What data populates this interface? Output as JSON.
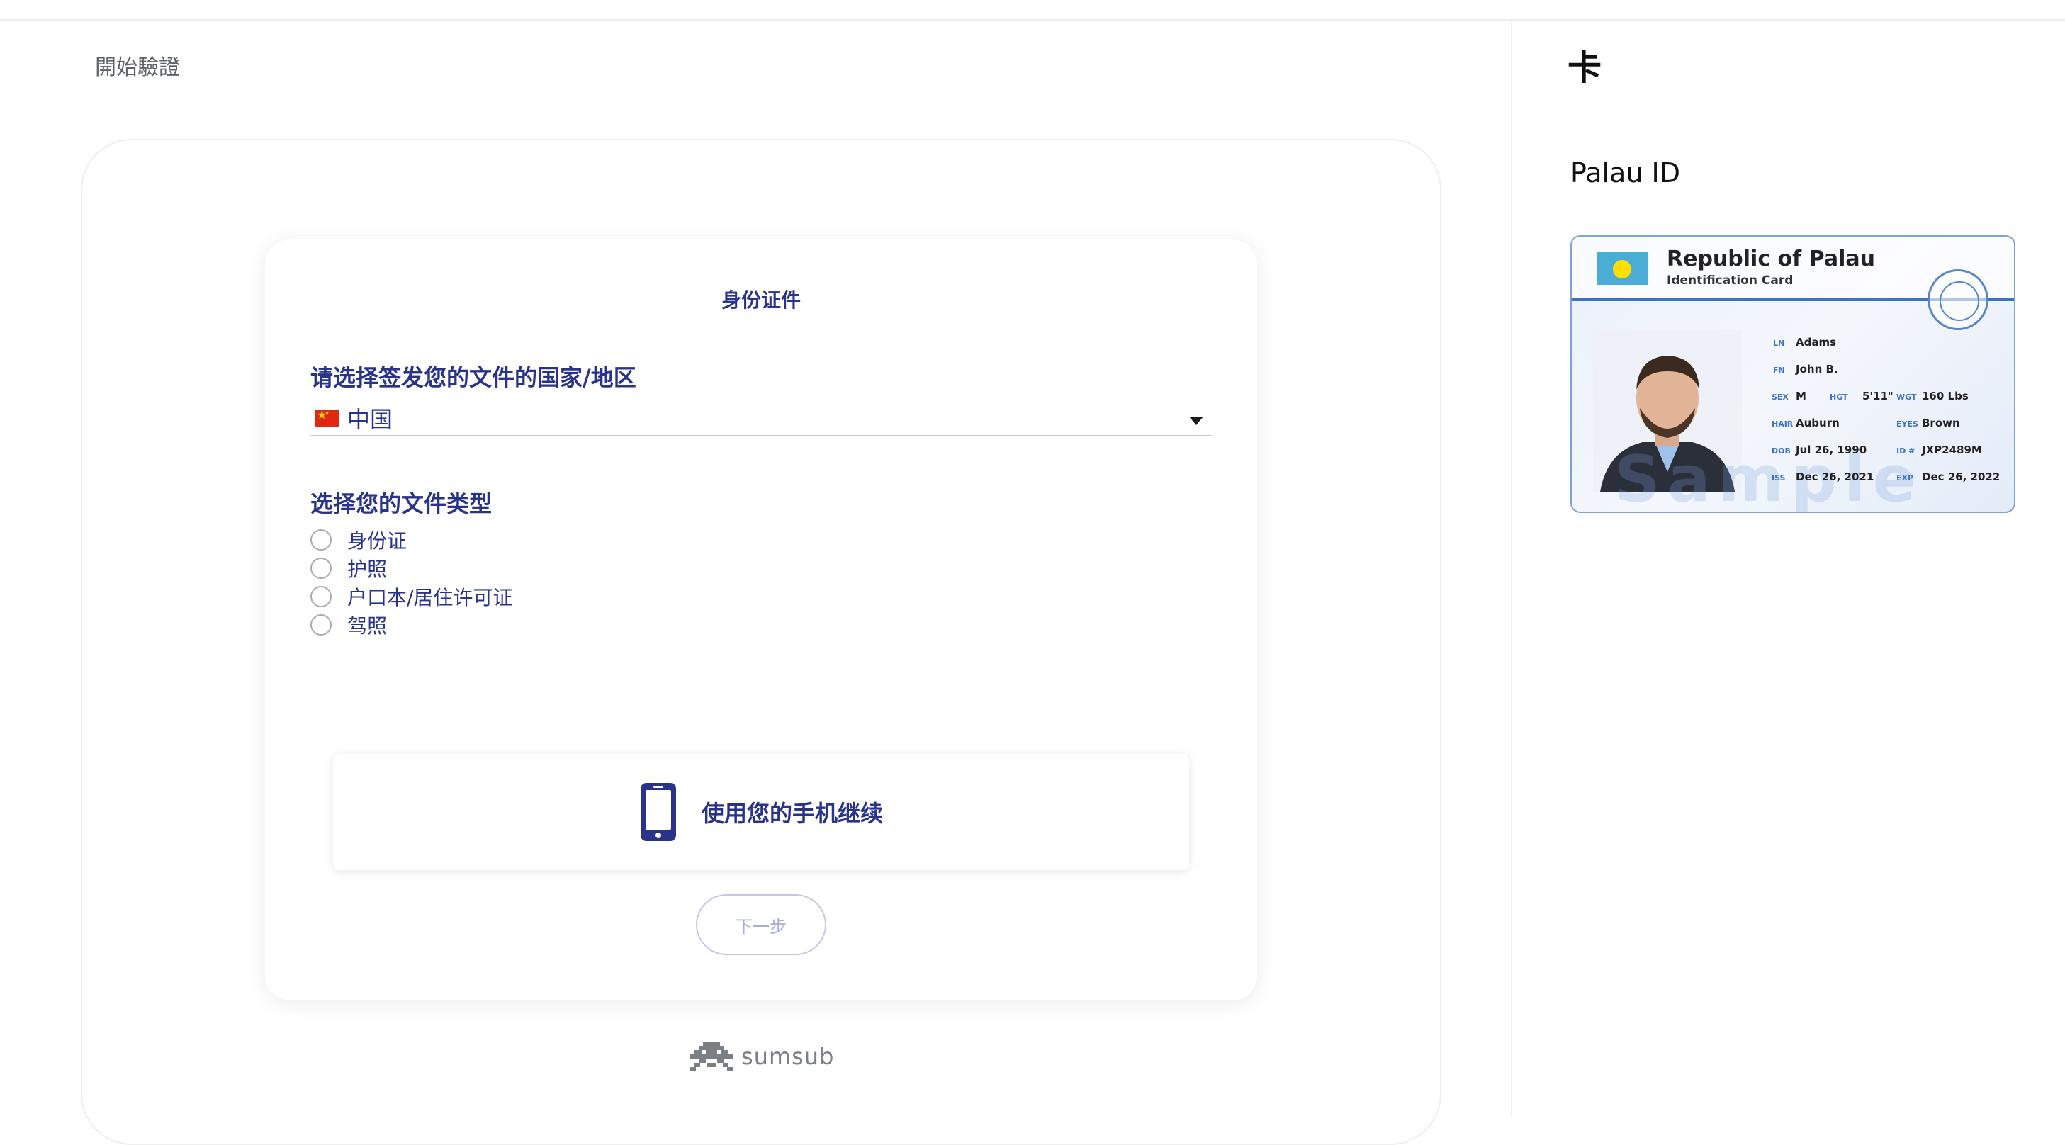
{
  "page": {
    "title": "開始驗證"
  },
  "form": {
    "title": "身份证件",
    "country_label": "请选择签发您的文件的国家/地区",
    "country_value": "中国",
    "doc_type_label": "选择您的文件类型",
    "doc_types": [
      "身份证",
      "护照",
      "户口本/居住许可证",
      "驾照"
    ],
    "phone_text": "使用您的手机继续",
    "next_label": "下一步"
  },
  "footer": {
    "brand": "sumsub"
  },
  "side": {
    "mark": "卡",
    "title": "Palau ID",
    "card": {
      "republic": "Republic of Palau",
      "subtitle": "Identification Card",
      "watermark": "Sample",
      "fields": {
        "ln_label": "LN",
        "ln": "Adams",
        "fn_label": "FN",
        "fn": "John B.",
        "sex_label": "SEX",
        "sex": "M",
        "hgt_label": "HGT",
        "hgt": "5'11\"",
        "wgt_label": "WGT",
        "wgt": "160 Lbs",
        "hair_label": "HAIR",
        "hair": "Auburn",
        "eyes_label": "EYES",
        "eyes": "Brown",
        "dob_label": "DOB",
        "dob": "Jul 26, 1990",
        "id_label": "ID #",
        "id": "JXP2489M",
        "iss_label": "ISS",
        "iss": "Dec 26, 2021",
        "exp_label": "EXP",
        "exp": "Dec 26, 2022"
      }
    }
  },
  "colors": {
    "accent": "#283389",
    "card_border": "#7ea3da",
    "muted": "#5f6368"
  },
  "icons": {
    "phone": "smartphone-icon",
    "select": "chevron-down-icon",
    "brand": "sumsub-logo-icon"
  }
}
